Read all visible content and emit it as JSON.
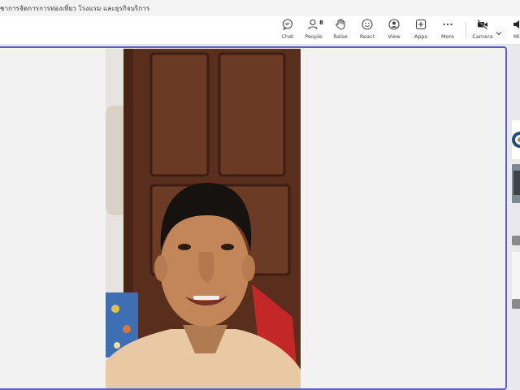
{
  "window": {
    "title": "ชาการจัดการการท่องเที่ยว โรงแรม และธุรกิจบริการ"
  },
  "toolbar": {
    "chat": {
      "label": "Chat",
      "icon": "chat-icon"
    },
    "people": {
      "label": "People",
      "count": "8",
      "icon": "people-icon"
    },
    "raise": {
      "label": "Raise",
      "icon": "hand-icon"
    },
    "react": {
      "label": "React",
      "icon": "smiley-icon"
    },
    "view": {
      "label": "View",
      "icon": "view-icon"
    },
    "apps": {
      "label": "Apps",
      "icon": "apps-plus-icon"
    },
    "more": {
      "label": "More",
      "icon": "more-dots-icon"
    },
    "camera": {
      "label": "Camera",
      "icon": "camera-off-icon"
    },
    "mic": {
      "label": "Mi",
      "icon": "speaker-icon"
    }
  },
  "colors": {
    "accent": "#5b5fc7",
    "stage_background": "#f2f2f3",
    "toolbar_background": "#ffffff"
  }
}
